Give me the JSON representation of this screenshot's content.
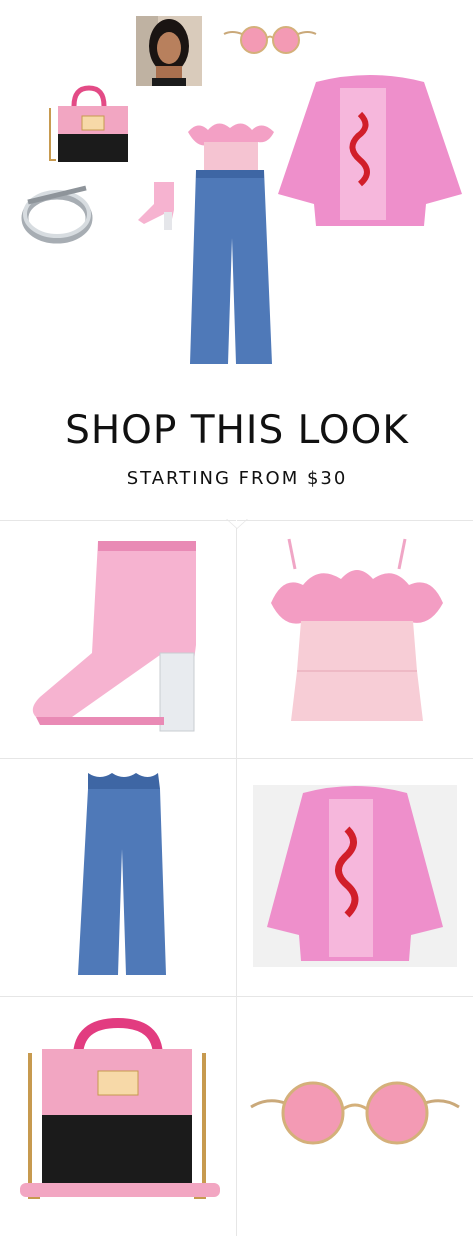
{
  "header": {
    "title": "SHOP THIS LOOK",
    "subtitle": "STARTING FROM $30"
  },
  "colors": {
    "pink": "#f4a6c8",
    "fur_pink": "#ee8fcb",
    "denim": "#4f79b8",
    "black": "#111111",
    "silver": "#9aa0a6"
  },
  "collage_items": [
    {
      "name": "portrait-photo"
    },
    {
      "name": "pink-round-sunglasses"
    },
    {
      "name": "pink-handbag"
    },
    {
      "name": "silver-nail-ring"
    },
    {
      "name": "clear-pink-boots"
    },
    {
      "name": "feather-top"
    },
    {
      "name": "wide-leg-jeans"
    },
    {
      "name": "pink-fur-coat"
    }
  ],
  "products": [
    {
      "name": "clear-pink-boots"
    },
    {
      "name": "pink-feather-top"
    },
    {
      "name": "wide-leg-jeans"
    },
    {
      "name": "pink-fur-coat-snake"
    },
    {
      "name": "pink-dg-handbag"
    },
    {
      "name": "round-pink-sunglasses"
    }
  ]
}
